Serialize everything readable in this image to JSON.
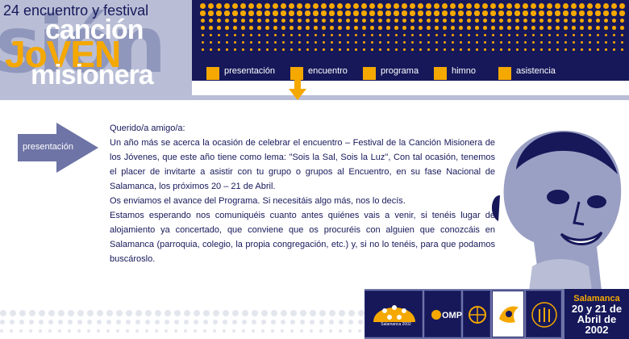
{
  "logo": {
    "line1": "24 encuentro y festival",
    "word_cancion": "canción",
    "word_joven": "JoVEN",
    "word_misionera": "misionera",
    "bg_word": "sión"
  },
  "nav": {
    "items": [
      {
        "label": "presentación"
      },
      {
        "label": "encuentro"
      },
      {
        "label": "programa"
      },
      {
        "label": "himno"
      },
      {
        "label": "asistencia"
      }
    ]
  },
  "section": {
    "label": "presentación"
  },
  "letter": {
    "greeting": "Querido/a amigo/a:",
    "paragraph1": "Un año más se acerca la ocasión de celebrar el encuentro – Festival de la Canción Misionera de los Jóvenes, que este año tiene como lema: \"Sois la Sal, Sois la Luz\", Con tal ocasión, tenemos el placer de invitarte a asistir con tu grupo o grupos al Encuentro, en su fase Nacional de Salamanca, los próximos 20 – 21 de Abril.",
    "paragraph2": "Os enviamos el avance del Programa. Si necesitáis algo más, nos lo decís.",
    "paragraph3": "Estamos esperando nos comuniquéis cuanto antes quiénes vais a venir, si tenéis lugar de alojamiento ya concertado, que conviene que os procuréis con alguien que conozcáis en Salamanca (parroquia, colegio, la propia congregación, etc.) y, si no lo tenéis, para que podamos buscároslo."
  },
  "footer": {
    "logo_caption": "Salamanca 2002",
    "omp_label": "OMP",
    "city": "Salamanca",
    "date_line1": "20 y 21 de",
    "date_line2": "Abril de",
    "date_line3": "2002"
  },
  "colors": {
    "navy": "#16185a",
    "orange": "#f5a800",
    "lavender": "#b9bed6",
    "slate": "#6e74a6"
  }
}
